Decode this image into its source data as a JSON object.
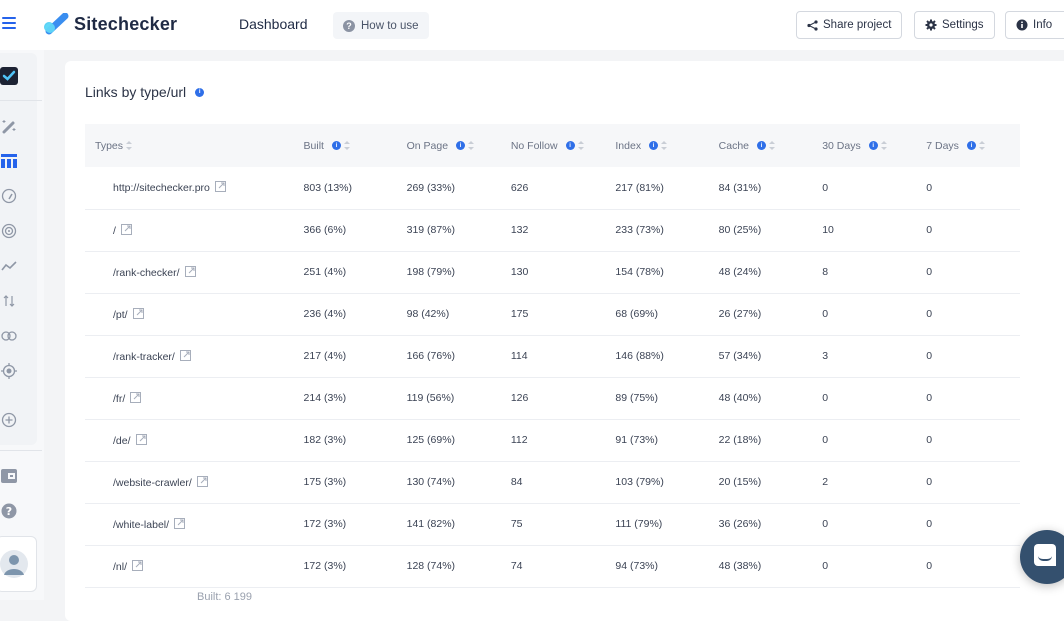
{
  "app": {
    "brand": "Sitechecker",
    "page_title": "Dashboard",
    "how_to_use": "How to use",
    "accent": "#2563eb"
  },
  "toolbar": {
    "share_label": "Share project",
    "settings_label": "Settings",
    "info_label": "Info"
  },
  "sidebar": {
    "items": [
      {
        "icon": "project-check-icon"
      },
      {
        "icon": "magic-wand-icon"
      },
      {
        "icon": "table-grid-icon",
        "active": true
      },
      {
        "icon": "speedometer-icon"
      },
      {
        "icon": "radar-icon"
      },
      {
        "icon": "trend-line-icon"
      },
      {
        "icon": "sort-arrows-icon"
      },
      {
        "icon": "link-icon"
      },
      {
        "icon": "target-icon"
      },
      {
        "icon": "add-circle-icon"
      },
      {
        "icon": "wallet-icon"
      },
      {
        "icon": "help-icon"
      },
      {
        "icon": "user-avatar-icon"
      }
    ]
  },
  "card": {
    "title": "Links by type/url",
    "footer": "Built: 6 199"
  },
  "table": {
    "headers": [
      "Types",
      "Built",
      "On Page",
      "No Follow",
      "Index",
      "Cache",
      "30 Days",
      "7 Days"
    ],
    "rows": [
      {
        "type": "http://sitechecker.pro",
        "built": "803 (13%)",
        "on_page": "269 (33%)",
        "no_follow": "626",
        "index": "217 (81%)",
        "cache": "84 (31%)",
        "d30": "0",
        "d7": "0"
      },
      {
        "type": "/",
        "built": "366 (6%)",
        "on_page": "319 (87%)",
        "no_follow": "132",
        "index": "233 (73%)",
        "cache": "80 (25%)",
        "d30": "10",
        "d7": "0"
      },
      {
        "type": "/rank-checker/",
        "built": "251 (4%)",
        "on_page": "198 (79%)",
        "no_follow": "130",
        "index": "154 (78%)",
        "cache": "48 (24%)",
        "d30": "8",
        "d7": "0"
      },
      {
        "type": "/pt/",
        "built": "236 (4%)",
        "on_page": "98 (42%)",
        "no_follow": "175",
        "index": "68 (69%)",
        "cache": "26 (27%)",
        "d30": "0",
        "d7": "0"
      },
      {
        "type": "/rank-tracker/",
        "built": "217 (4%)",
        "on_page": "166 (76%)",
        "no_follow": "114",
        "index": "146 (88%)",
        "cache": "57 (34%)",
        "d30": "3",
        "d7": "0"
      },
      {
        "type": "/fr/",
        "built": "214 (3%)",
        "on_page": "119 (56%)",
        "no_follow": "126",
        "index": "89 (75%)",
        "cache": "48 (40%)",
        "d30": "0",
        "d7": "0"
      },
      {
        "type": "/de/",
        "built": "182 (3%)",
        "on_page": "125 (69%)",
        "no_follow": "112",
        "index": "91 (73%)",
        "cache": "22 (18%)",
        "d30": "0",
        "d7": "0"
      },
      {
        "type": "/website-crawler/",
        "built": "175 (3%)",
        "on_page": "130 (74%)",
        "no_follow": "84",
        "index": "103 (79%)",
        "cache": "20 (15%)",
        "d30": "2",
        "d7": "0"
      },
      {
        "type": "/white-label/",
        "built": "172 (3%)",
        "on_page": "141 (82%)",
        "no_follow": "75",
        "index": "111 (79%)",
        "cache": "36 (26%)",
        "d30": "0",
        "d7": "0"
      },
      {
        "type": "/nl/",
        "built": "172 (3%)",
        "on_page": "128 (74%)",
        "no_follow": "74",
        "index": "94 (73%)",
        "cache": "48 (38%)",
        "d30": "0",
        "d7": "0"
      }
    ]
  },
  "chat": {
    "icon": "chat-bubble-icon"
  }
}
